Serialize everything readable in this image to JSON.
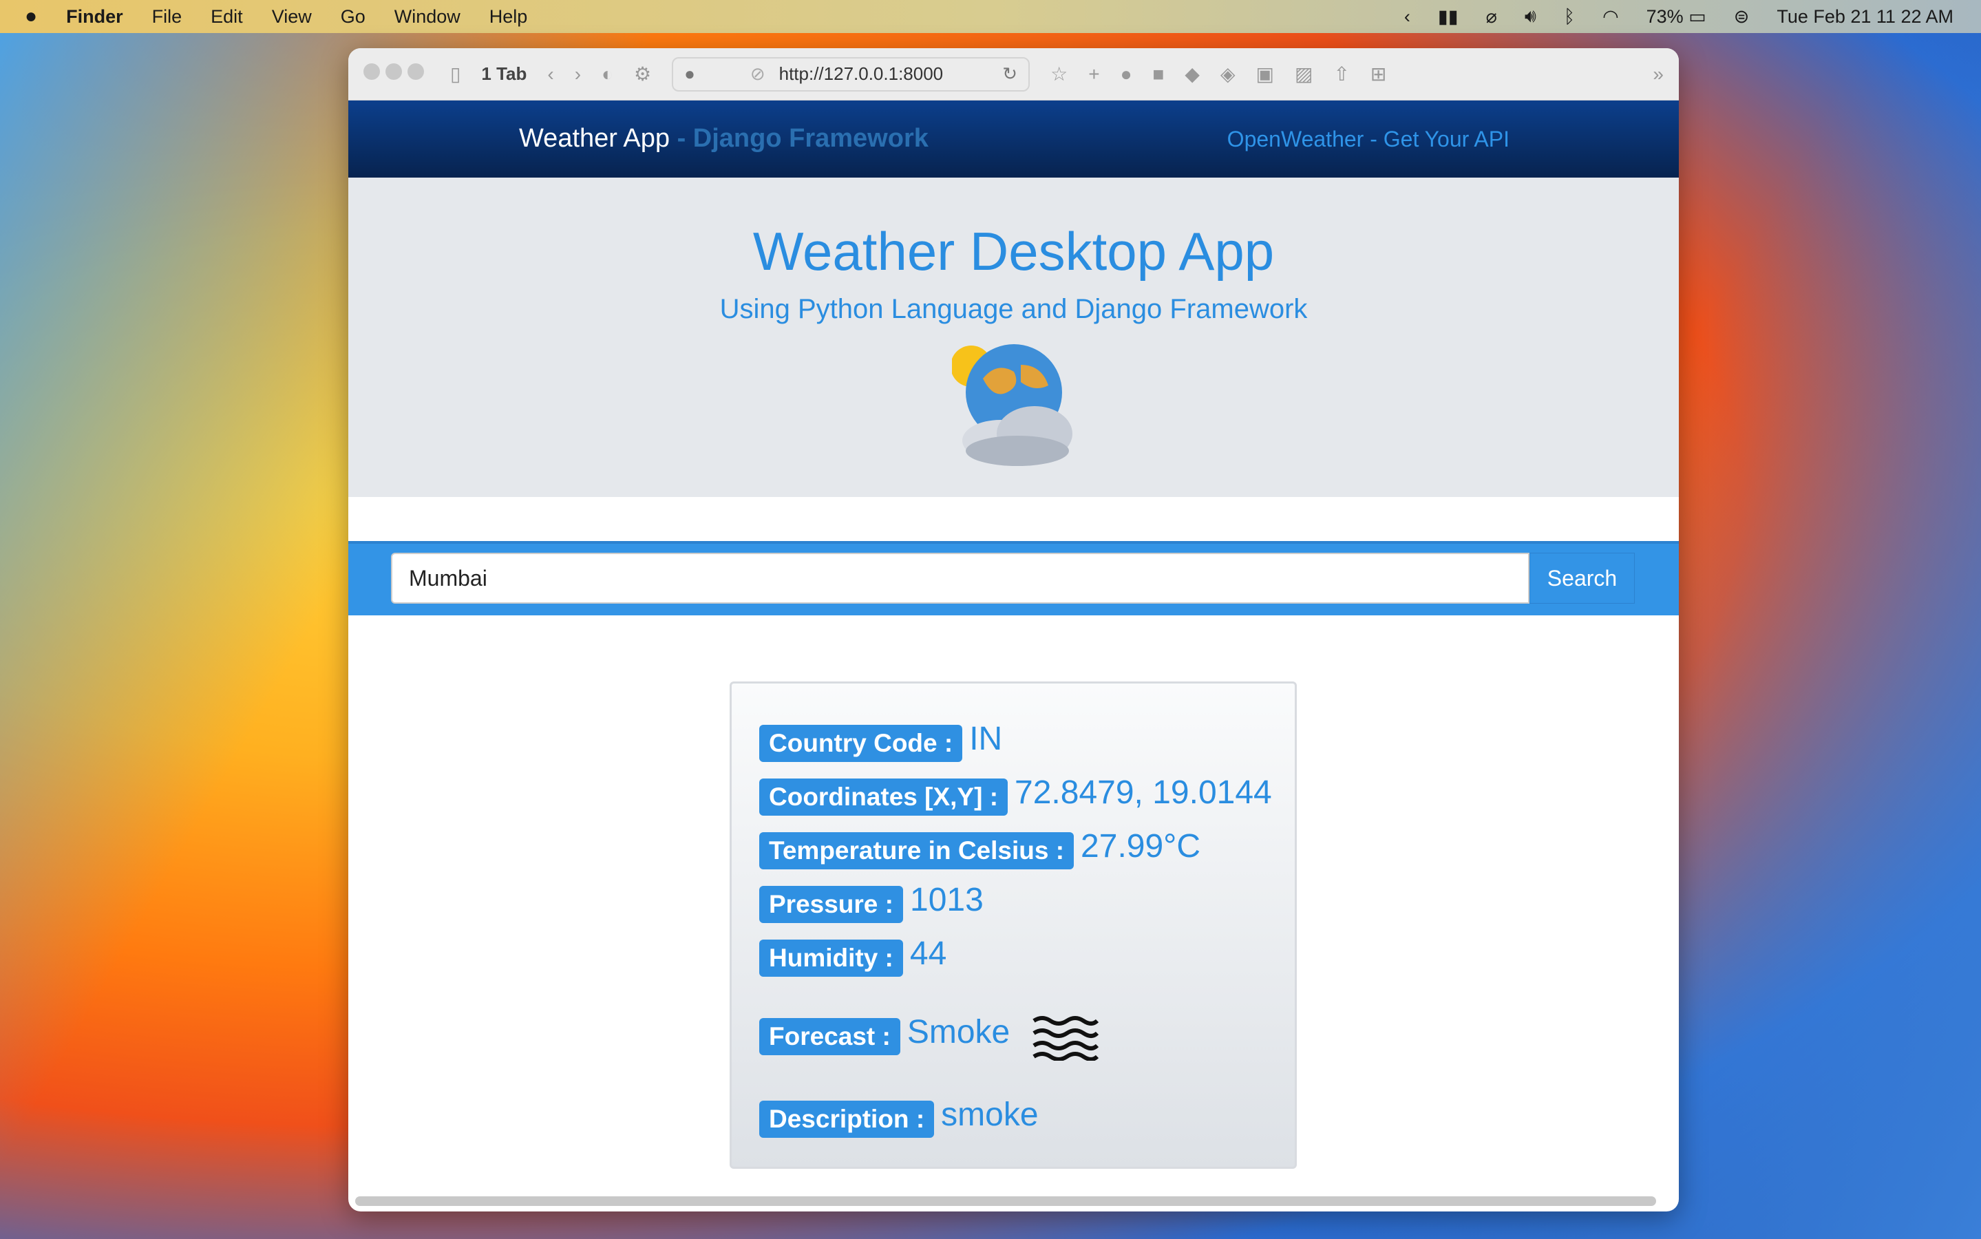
{
  "menubar": {
    "app": "Finder",
    "items": [
      "File",
      "Edit",
      "View",
      "Go",
      "Window",
      "Help"
    ],
    "battery": "73%",
    "datetime": "Tue Feb 21  11 22 AM"
  },
  "browser": {
    "tabs": "1 Tab",
    "url": "http://127.0.0.1:8000"
  },
  "navbar": {
    "brand": "Weather App",
    "brand_sep": " - ",
    "brand_fw": "Django Framework",
    "link": "OpenWeather - Get Your API"
  },
  "hero": {
    "title": "Weather Desktop App",
    "subtitle": "Using Python Language and Django Framework"
  },
  "search": {
    "value": "Mumbai",
    "button": "Search"
  },
  "weather": [
    {
      "label": "Country Code :",
      "value": "IN"
    },
    {
      "label": "Coordinates [X,Y] :",
      "value": "72.8479, 19.0144"
    },
    {
      "label": "Temperature in Celsius :",
      "value": "27.99°C"
    },
    {
      "label": "Pressure :",
      "value": "1013"
    },
    {
      "label": "Humidity :",
      "value": "44"
    },
    {
      "label": "Forecast :",
      "value": "Smoke"
    },
    {
      "label": "Description :",
      "value": "smoke"
    }
  ]
}
